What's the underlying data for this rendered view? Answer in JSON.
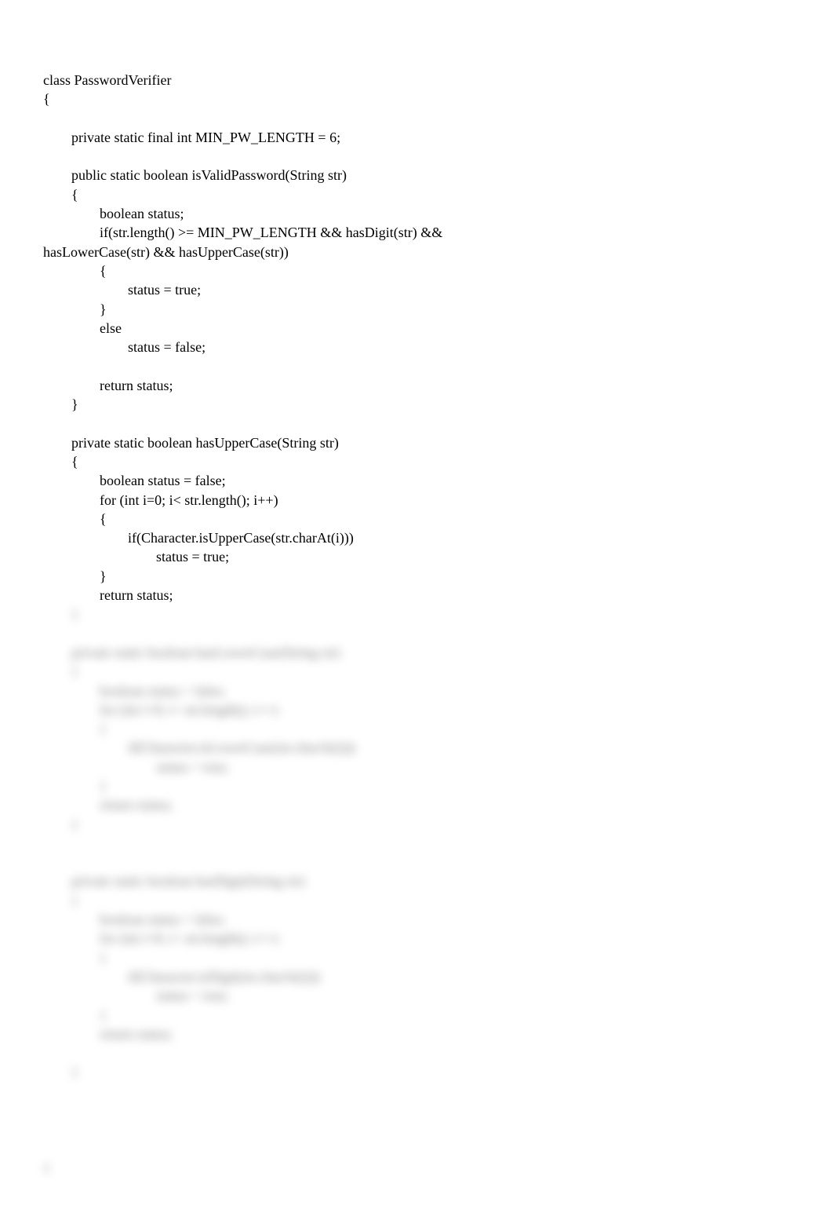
{
  "code_visible": "class PasswordVerifier\n{\n\n\tprivate static final int MIN_PW_LENGTH = 6;\n\n\tpublic static boolean isValidPassword(String str)\n\t{\n\t\tboolean status;\n\t\tif(str.length() >= MIN_PW_LENGTH && hasDigit(str) && \nhasLowerCase(str) && hasUpperCase(str))\n\t\t{\n\t\t\tstatus = true;\n\t\t}\n\t\telse\n\t\t\tstatus = false;\n\n\t\treturn status;\n\t}\n\n\tprivate static boolean hasUpperCase(String str)\n\t{\n\t\tboolean status = false;\n\t\tfor (int i=0; i< str.length(); i++)\n\t\t{\n\t\t\tif(Character.isUpperCase(str.charAt(i)))\n\t\t\t\tstatus = true;\n\t\t}\n\t\treturn status;",
  "code_blurred": "\t}\n\n\tprivate static boolean hasLowerCase(String str)\n\t{\n\t\tboolean status = false;\n\t\tfor (int i=0; i< str.length(); i++)\n\t\t{\n\t\t\tif(Character.isLowerCase(str.charAt(i)))\n\t\t\t\tstatus = true;\n\t\t}\n\t\treturn status;\n\t}\n\n\n\tprivate static boolean hasDigit(String str)\n\t{\n\t\tboolean status = false;\n\t\tfor (int i=0; i< str.length(); i++)\n\t\t{\n\t\t\tif(Character.isDigit(str.charAt(i)))\n\t\t\t\tstatus = true;\n\t\t}\n\t\treturn status;\n\n\t}\n\n\n\n\n}"
}
